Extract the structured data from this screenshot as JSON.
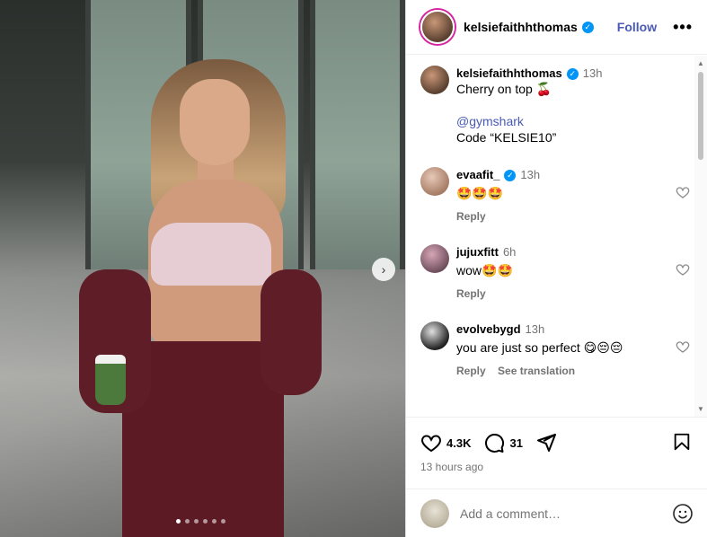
{
  "post": {
    "username": "kelsiefaithhthomas",
    "follow_label": "Follow",
    "more_label": "•••",
    "carousel_dots": 6,
    "active_dot": 1
  },
  "caption": {
    "username": "kelsiefaithhthomas",
    "time": "13h",
    "line1": "Cherry on top 🍒",
    "mention": "@gymshark",
    "code": "Code “KELSIE10”"
  },
  "comments": [
    {
      "username": "evaafit_",
      "verified": true,
      "time": "13h",
      "text": "🤩🤩🤩",
      "reply": "Reply"
    },
    {
      "username": "jujuxfitt",
      "verified": false,
      "time": "6h",
      "text": "wow🤩🤩",
      "reply": "Reply"
    },
    {
      "username": "evolvebygd",
      "verified": false,
      "time": "13h",
      "text": "you are just so perfect 😋😔😔",
      "reply": "Reply",
      "translate": "See translation"
    }
  ],
  "stats": {
    "likes": "4.3K",
    "comments": "31",
    "time_ago": "13 hours ago"
  },
  "add_comment": {
    "placeholder": "Add a comment…"
  }
}
